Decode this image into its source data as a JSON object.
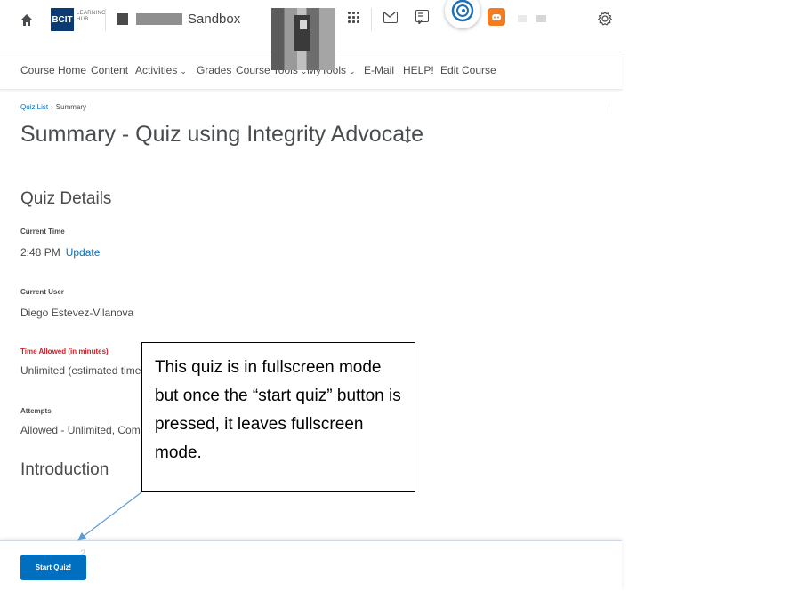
{
  "header": {
    "logo_text": "BCIT",
    "logo_sub": "LEARNING HUB",
    "course_name": "Sandbox",
    "icons": [
      "home-icon",
      "grid-icon",
      "mail-icon",
      "chat-icon",
      "integrity-advocate-icon",
      "gear-icon"
    ]
  },
  "nav": {
    "items": [
      {
        "label": "Course Home",
        "has_menu": false
      },
      {
        "label": "Content",
        "has_menu": false
      },
      {
        "label": "Activities",
        "has_menu": true
      },
      {
        "label": "Grades",
        "has_menu": false
      },
      {
        "label": "Course Tools",
        "has_menu": true
      },
      {
        "label": "MyTools",
        "has_menu": true
      },
      {
        "label": "E-Mail",
        "has_menu": false
      },
      {
        "label": "HELP!",
        "has_menu": false
      },
      {
        "label": "Edit Course",
        "has_menu": false
      }
    ]
  },
  "breadcrumb": {
    "link": "Quiz List",
    "current": "Summary"
  },
  "page": {
    "title": "Summary - Quiz using Integrity Advocate",
    "quiz_details_heading": "Quiz Details",
    "current_time_label": "Current Time",
    "current_time_value": "2:48 PM",
    "update_link": "Update",
    "current_user_label": "Current User",
    "current_user_value": "Diego Estevez-Vilanova",
    "time_allowed_label": "Time Allowed (in minutes)",
    "time_allowed_value": "Unlimited (estimated time re",
    "attempts_label": "Attempts",
    "attempts_value": "Allowed - Unlimited, Compl",
    "introduction_heading": "Introduction"
  },
  "callout": {
    "text": "This quiz is in fullscreen mode but once the “start quiz” button is pressed, it leaves fullscreen mode."
  },
  "footer": {
    "start_button": "Start Quiz!"
  },
  "colors": {
    "link": "#006fbf",
    "required_label": "#cd2026",
    "brand": "#0a3b73",
    "badge": "#f37c22"
  }
}
